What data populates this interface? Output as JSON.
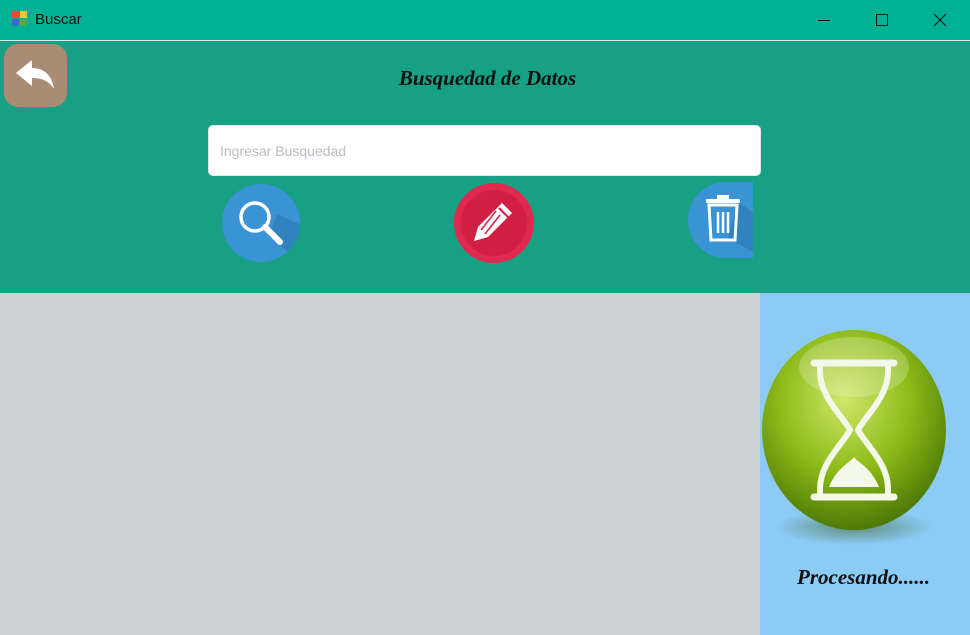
{
  "window": {
    "title": "Buscar",
    "app_icon": "windows-forms-app-icon",
    "controls": [
      "minimize-icon",
      "maximize-icon",
      "close-icon"
    ]
  },
  "header": {
    "title": "Busquedad de Datos",
    "back_icon": "back-arrow-icon",
    "background": "#17a083"
  },
  "search": {
    "value": "",
    "placeholder": "Ingresar Busquedad"
  },
  "actions": [
    {
      "name": "search",
      "icon": "magnifier-icon",
      "color": "#3a93d4"
    },
    {
      "name": "edit",
      "icon": "pencil-icon",
      "color": "#e1294f"
    },
    {
      "name": "delete",
      "icon": "trash-icon",
      "color": "#3a93d4"
    }
  ],
  "status": {
    "label": "Procesando......",
    "icon": "hourglass-icon",
    "panel_color": "#8ccbf6"
  },
  "colors": {
    "titlebar": "#00b294",
    "content": "#cbd1d1"
  }
}
